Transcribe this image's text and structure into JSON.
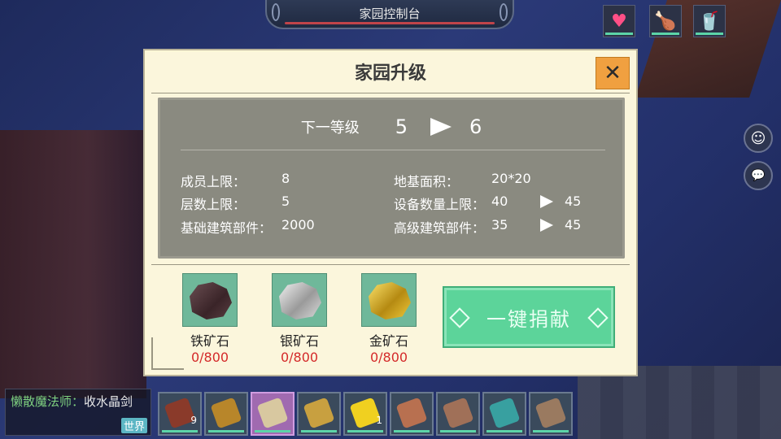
{
  "top_banner": {
    "title": "家园控制台"
  },
  "status_icons": [
    {
      "name": "heart-icon",
      "glyph": "♥",
      "color": "#ff4f86"
    },
    {
      "name": "meat-icon",
      "glyph": "🍗",
      "color": "#ffcc33"
    },
    {
      "name": "drink-icon",
      "glyph": "🥤",
      "color": "#4fd8d0"
    }
  ],
  "side_buttons": {
    "emote_glyph": "☺",
    "chat_glyph": "💬"
  },
  "dialog": {
    "title": "家园升级",
    "close_glyph": "✕",
    "next_level_label": "下一等级",
    "current_level": "5",
    "next_level": "6",
    "stats_left": [
      {
        "label": "成员上限：",
        "value": "8"
      },
      {
        "label": "层数上限：",
        "value": "5"
      },
      {
        "label": "基础建筑部件：",
        "value": "2000"
      }
    ],
    "stats_right": [
      {
        "label": "地基面积：",
        "value": "20*20"
      },
      {
        "label": "设备数量上限：",
        "value": "40",
        "next": "45"
      },
      {
        "label": "高级建筑部件：",
        "value": "35",
        "next": "45"
      }
    ],
    "ores": [
      {
        "name": "铁矿石",
        "count": "0/800",
        "kind": "iron"
      },
      {
        "name": "银矿石",
        "count": "0/800",
        "kind": "silver"
      },
      {
        "name": "金矿石",
        "count": "0/800",
        "kind": "gold"
      }
    ],
    "donate_label": "一键捐献"
  },
  "chat": {
    "speaker": "懒散魔法师：",
    "message": "收水晶剑",
    "channel": "世界"
  },
  "hotbar": [
    {
      "name": "steak-item",
      "count": "9",
      "color": "#8a3a2a"
    },
    {
      "name": "horn-item",
      "count": "",
      "color": "#b8862a"
    },
    {
      "name": "blade-item",
      "count": "",
      "color": "#d8c8a0",
      "selected": true
    },
    {
      "name": "bow-item",
      "count": "",
      "color": "#c8a040"
    },
    {
      "name": "flower-item",
      "count": "1",
      "color": "#f0d020"
    },
    {
      "name": "bat-item",
      "count": "",
      "color": "#b87050"
    },
    {
      "name": "hide-item",
      "count": "",
      "color": "#a07058"
    },
    {
      "name": "spear-item",
      "count": "",
      "color": "#38a0a0"
    },
    {
      "name": "chest-item",
      "count": "",
      "color": "#9a7a60"
    }
  ]
}
